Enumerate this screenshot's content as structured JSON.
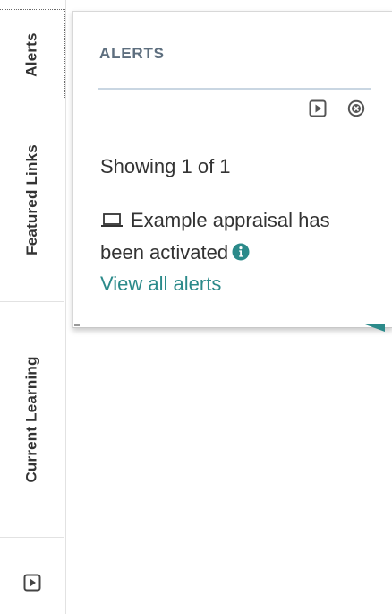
{
  "rail": {
    "tabs": [
      {
        "label": "Alerts",
        "active": true
      },
      {
        "label": "Featured Links",
        "active": false
      },
      {
        "label": "Current Learning",
        "active": false
      }
    ],
    "bottom_button_icon": "play-square-icon"
  },
  "popover": {
    "title": "ALERTS",
    "controls": {
      "play_icon": "play-square-icon",
      "close_icon": "close-circle-icon"
    },
    "count_text": "Showing 1 of 1",
    "alerts": [
      {
        "icon": "laptop-icon",
        "text": "Example appraisal has been activated",
        "info_icon": "info-circle-icon"
      }
    ],
    "view_all_label": "View all alerts"
  },
  "colors": {
    "title": "#5d6e7e",
    "rule": "#c9d6e2",
    "link": "#2b8a8a",
    "text": "#333333",
    "info": "#2b8a8a"
  }
}
